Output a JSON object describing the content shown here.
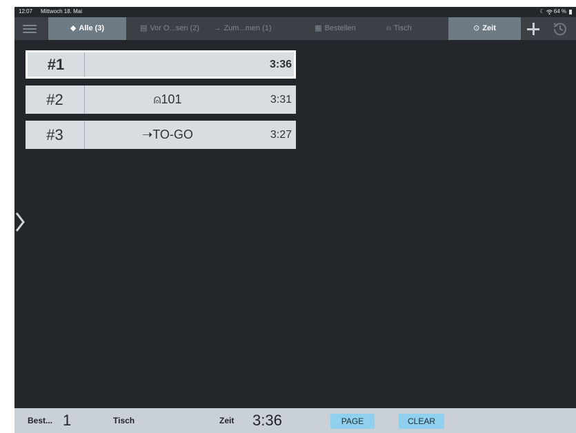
{
  "status_bar": {
    "time": "12:07",
    "date": "Mittwoch 18. Mai",
    "battery": "64 %"
  },
  "tabs": [
    {
      "icon": "◆",
      "label": "Alle (3)",
      "active": true
    },
    {
      "icon": "▤",
      "label": "Vor O...sen (2)",
      "active": false
    },
    {
      "icon": "→",
      "label": "Zum...men (1)",
      "active": false
    },
    {
      "icon": "▦",
      "label": "Bestellen",
      "active": false
    },
    {
      "icon": "⍝",
      "label": "Tisch",
      "active": false
    },
    {
      "icon": "⊙",
      "label": "Zeit",
      "active": true
    }
  ],
  "orders": [
    {
      "number": "#1",
      "label": "",
      "time": "3:36",
      "selected": true
    },
    {
      "number": "#2",
      "label": "⍝101",
      "time": "3:31",
      "selected": false
    },
    {
      "number": "#3",
      "label": "➝TO-GO",
      "time": "3:27",
      "selected": false
    }
  ],
  "footer": {
    "order_label": "Best...",
    "order_value": "1",
    "table_label": "Tisch",
    "time_label": "Zeit",
    "time_value": "3:36",
    "page_button": "PAGE",
    "clear_button": "CLEAR"
  },
  "colors": {
    "background": "#23272b",
    "tabbar": "#3b4046",
    "tab_active": "#6e7b85",
    "order_card": "#d8dde2",
    "footer": "#c9d0d6",
    "footer_button": "#8fd0ee"
  }
}
